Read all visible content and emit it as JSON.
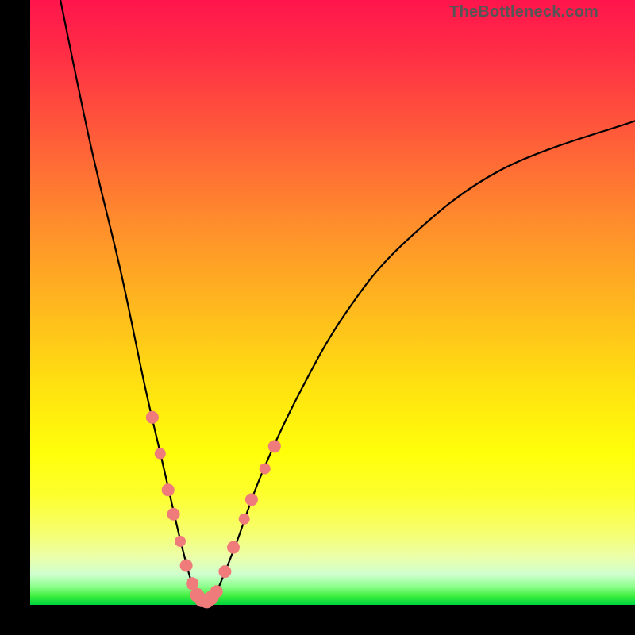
{
  "watermark": "TheBottleneck.com",
  "chart_data": {
    "type": "line",
    "title": "",
    "xlabel": "",
    "ylabel": "",
    "xlim": [
      0,
      100
    ],
    "ylim": [
      0,
      100
    ],
    "grid": false,
    "legend": false,
    "series": [
      {
        "name": "bottleneck-curve",
        "x": [
          5,
          10,
          15,
          19,
          22,
          25,
          27,
          29,
          30.5,
          34,
          38,
          44,
          52,
          62,
          78,
          100
        ],
        "y": [
          100,
          76,
          55,
          36,
          23,
          10,
          3,
          0.5,
          1.5,
          10,
          21,
          34,
          48,
          60,
          72,
          80
        ]
      }
    ],
    "markers": {
      "name": "highlighted-points",
      "color": "#ef7b7b",
      "points": [
        {
          "x": 20.2,
          "y": 31.0,
          "r": 8
        },
        {
          "x": 21.5,
          "y": 25.0,
          "r": 7
        },
        {
          "x": 22.8,
          "y": 19.0,
          "r": 8
        },
        {
          "x": 23.7,
          "y": 15.0,
          "r": 8
        },
        {
          "x": 24.8,
          "y": 10.5,
          "r": 7
        },
        {
          "x": 25.8,
          "y": 6.5,
          "r": 8
        },
        {
          "x": 26.8,
          "y": 3.5,
          "r": 8
        },
        {
          "x": 27.6,
          "y": 1.6,
          "r": 9
        },
        {
          "x": 28.4,
          "y": 0.8,
          "r": 9
        },
        {
          "x": 29.2,
          "y": 0.6,
          "r": 9
        },
        {
          "x": 30.0,
          "y": 1.2,
          "r": 9
        },
        {
          "x": 30.8,
          "y": 2.2,
          "r": 8
        },
        {
          "x": 32.2,
          "y": 5.5,
          "r": 8
        },
        {
          "x": 33.6,
          "y": 9.5,
          "r": 8
        },
        {
          "x": 35.4,
          "y": 14.2,
          "r": 7
        },
        {
          "x": 36.6,
          "y": 17.4,
          "r": 8
        },
        {
          "x": 38.8,
          "y": 22.5,
          "r": 7
        },
        {
          "x": 40.4,
          "y": 26.2,
          "r": 8
        }
      ]
    },
    "background_gradient": {
      "top": "#ff154d",
      "upper_mid": "#ff8a2d",
      "mid": "#ffe210",
      "lower_mid": "#fdff2f",
      "bottom": "#00d43e"
    }
  }
}
